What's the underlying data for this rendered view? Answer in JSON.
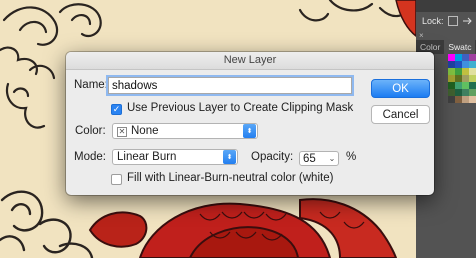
{
  "panel": {
    "lock_label": "Lock:",
    "close_glyph": "×",
    "tabs": [
      {
        "label": "Color",
        "active": false
      },
      {
        "label": "Swatc",
        "active": true
      }
    ],
    "swatches": [
      "#ff00ff",
      "#00a0e0",
      "#4060c0",
      "#a040a0",
      "#2040a0",
      "#2050c0",
      "#4090e0",
      "#40b0d0",
      "#80c040",
      "#40a040",
      "#c0c040",
      "#e0e0a0",
      "#a0a030",
      "#607020",
      "#a0a060",
      "#c0d060",
      "#206020",
      "#40a070",
      "#60c060",
      "#207050",
      "#406030",
      "#206040",
      "#408060",
      "#60a060",
      "#404040",
      "#806040",
      "#c0a080",
      "#e0c0a0"
    ]
  },
  "dialog": {
    "title": "New Layer",
    "name_label": "Name:",
    "name_value": "shadows",
    "clipping_label": "Use Previous Layer to Create Clipping Mask",
    "clipping_checked": true,
    "color_label": "Color:",
    "color_value": "None",
    "mode_label": "Mode:",
    "mode_value": "Linear Burn",
    "opacity_label": "Opacity:",
    "opacity_value": "65",
    "opacity_unit": "%",
    "fill_label": "Fill with Linear-Burn-neutral color (white)",
    "fill_checked": false,
    "ok_label": "OK",
    "cancel_label": "Cancel"
  }
}
